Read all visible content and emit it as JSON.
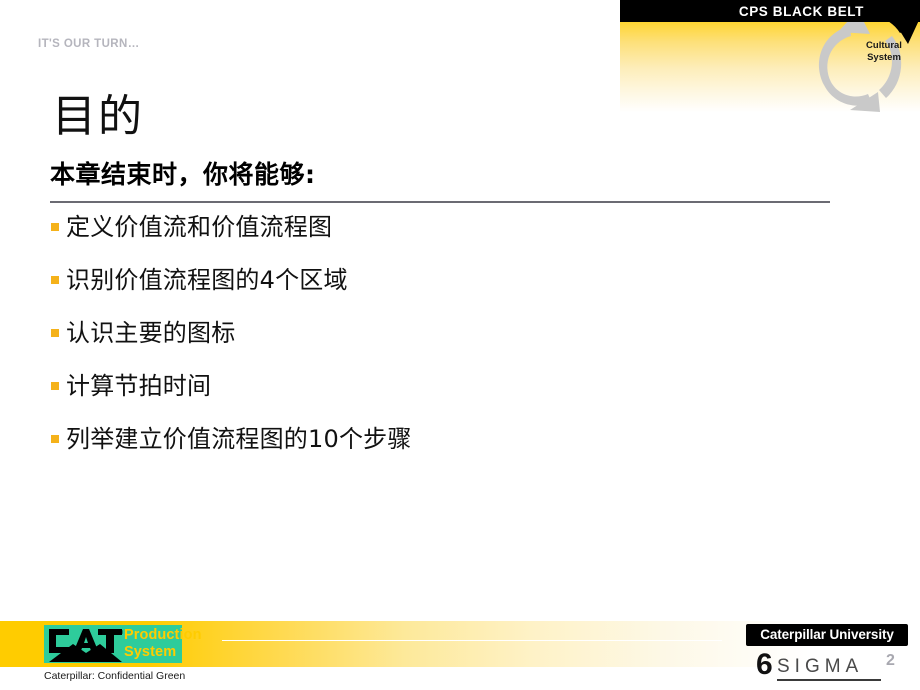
{
  "slide": {
    "eyebrow": "IT'S OUR TURN…",
    "title": "目的",
    "page_number": "2"
  },
  "header_banner": {
    "title": "CPS BLACK BELT",
    "cycle_label": "Cultural\nSystem",
    "cycle_label_line1": "Cultural",
    "cycle_label_line2": "System",
    "black_bar_color": "#000000",
    "gradient_start": "#ffcf00",
    "gradient_end": "#ffffff",
    "arrow_gray": "#c9c9c9",
    "arrow_black": "#000000"
  },
  "body": {
    "heading": "本章结束时，你将能够:",
    "bullets": [
      "定义价值流和价值流程图",
      "识别价值流程图的4个区域",
      "认识主要的图标",
      "计算节拍时间",
      "列举建立价值流程图的10个步骤"
    ],
    "bullet_color": "#f5b21a",
    "rule_color": "#6b6b73"
  },
  "footer": {
    "cat_wordmark": "CAT",
    "cat_trademark": "®",
    "production_line1": "Production",
    "production_line2": "System",
    "confidential": "Caterpillar: Confidential Green",
    "university_badge": "Caterpillar University",
    "sixsigma_numeral": "6",
    "sixsigma_word": "SIGMA",
    "bar_gradient_start": "#ffcc00",
    "bar_gradient_end": "#ffffff",
    "cat_green": "#2ecc9b",
    "cat_yellow": "#ffcc00"
  }
}
